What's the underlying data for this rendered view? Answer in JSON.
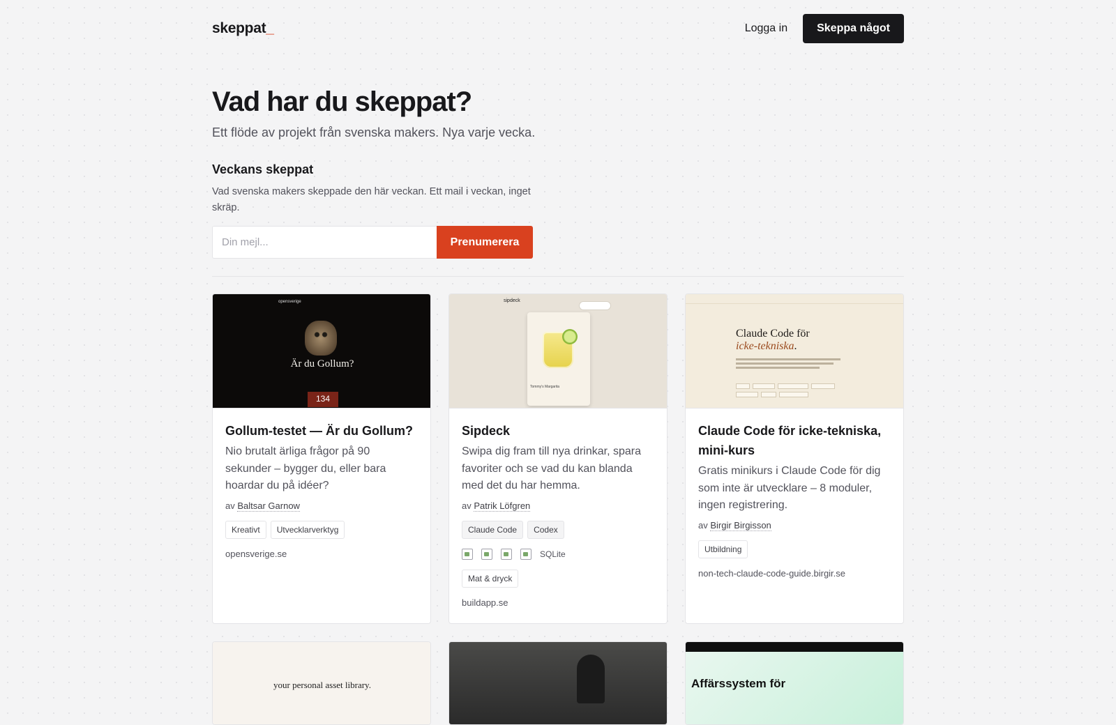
{
  "header": {
    "logo_text": "skeppat",
    "logo_cursor": "_",
    "login_label": "Logga in",
    "cta_label": "Skeppa något"
  },
  "hero": {
    "title": "Vad har du skeppat?",
    "subtitle": "Ett flöde av projekt från svenska makers. Nya varje vecka."
  },
  "newsletter": {
    "title": "Veckans skeppat",
    "description": "Vad svenska makers skeppade den här veckan. Ett mail i veckan, inget skräp.",
    "input_placeholder": "Din mejl...",
    "button_label": "Prenumerera"
  },
  "colors": {
    "accent": "#d9411f",
    "dark": "#18181b"
  },
  "projects": [
    {
      "title": "Gollum-testet — Är du Gollum?",
      "description": "Nio brutalt ärliga frågor på 90 sekunder – bygger du, eller bara hoardar du på idéer?",
      "author_prefix": "av",
      "author": "Baltsar Garnow",
      "tags": [
        "Kreativt",
        "Utvecklarverktyg"
      ],
      "link": "opensverige.se",
      "thumb": {
        "site": "opensverige",
        "question": "Är du Gollum?",
        "counter": "134"
      }
    },
    {
      "title": "Sipdeck",
      "description": "Swipa dig fram till nya drinkar, spara favoriter och se vad du kan blanda med det du har hemma.",
      "author_prefix": "av",
      "author": "Patrik Löfgren",
      "tools": [
        "Claude Code",
        "Codex"
      ],
      "stack_icons": [
        "broken-image-icon",
        "broken-image-icon",
        "broken-image-icon",
        "broken-image-icon"
      ],
      "stack_text": "SQLite",
      "tags": [
        "Mat & dryck"
      ],
      "link": "buildapp.se",
      "thumb": {
        "brand": "sipdeck",
        "drink": "Tommy's Margarita"
      }
    },
    {
      "title": "Claude Code för icke-tekniska, mini-kurs",
      "description": "Gratis minikurs i Claude Code för dig som inte är utvecklare – 8 moduler, ingen registrering.",
      "author_prefix": "av",
      "author": "Birgir Birgisson",
      "tags": [
        "Utbildning"
      ],
      "link": "non-tech-claude-code-guide.birgir.se",
      "thumb": {
        "heading_1": "Claude Code för",
        "heading_2": "icke-tekniska",
        "heading_dot": "."
      }
    }
  ],
  "more_projects": [
    {
      "thumb_text": "your personal asset library."
    },
    {
      "thumb_text": ""
    },
    {
      "thumb_text": "Affärssystem för"
    }
  ]
}
